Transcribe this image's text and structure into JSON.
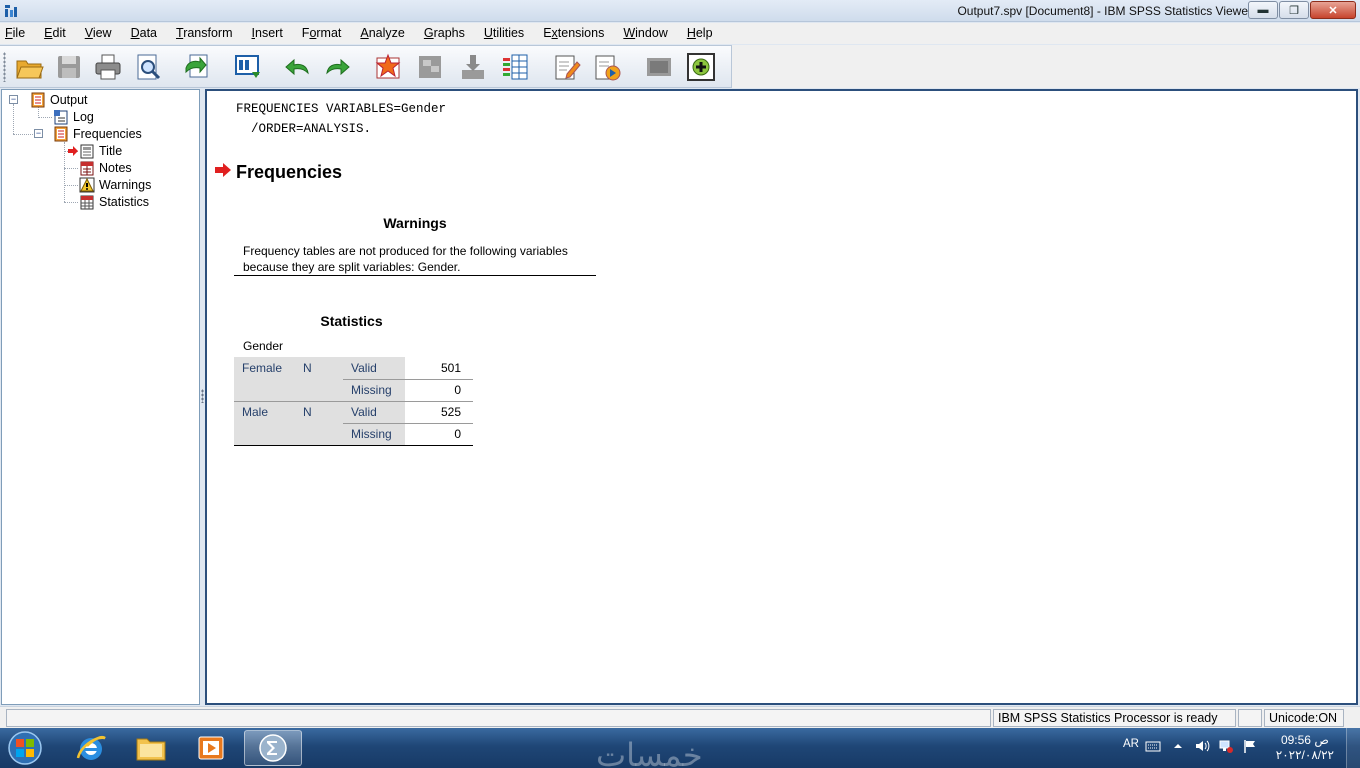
{
  "window": {
    "title": "Output7.spv [Document8] - IBM SPSS Statistics Viewer",
    "minimize": "▬",
    "maximize": "❐",
    "close": "✕"
  },
  "menu": [
    {
      "label": "File",
      "u": "F",
      "rest": "ile"
    },
    {
      "label": "Edit",
      "u": "E",
      "rest": "dit"
    },
    {
      "label": "View",
      "u": "V",
      "rest": "iew"
    },
    {
      "label": "Data",
      "u": "D",
      "rest": "ata"
    },
    {
      "label": "Transform",
      "u": "T",
      "rest": "ransform"
    },
    {
      "label": "Insert",
      "u": "I",
      "rest": "nsert"
    },
    {
      "label": "Format",
      "pre": "F",
      "u": "o",
      "rest": "rmat"
    },
    {
      "label": "Analyze",
      "u": "A",
      "rest": "nalyze"
    },
    {
      "label": "Graphs",
      "u": "G",
      "rest": "raphs"
    },
    {
      "label": "Utilities",
      "u": "U",
      "rest": "tilities"
    },
    {
      "label": "Extensions",
      "pre": "E",
      "u": "x",
      "rest": "tensions"
    },
    {
      "label": "Window",
      "u": "W",
      "rest": "indow"
    },
    {
      "label": "Help",
      "u": "H",
      "rest": "elp"
    }
  ],
  "toolbar": [
    {
      "name": "open-icon"
    },
    {
      "name": "save-icon"
    },
    {
      "name": "print-icon"
    },
    {
      "name": "print-preview-icon"
    },
    {
      "name": "export-icon"
    },
    {
      "name": "recall-dialog-icon"
    },
    {
      "name": "undo-icon"
    },
    {
      "name": "redo-icon"
    },
    {
      "name": "goto-data-icon"
    },
    {
      "name": "goto-case-icon"
    },
    {
      "name": "goto-variable-icon"
    },
    {
      "name": "variables-icon"
    },
    {
      "name": "insert-heading-icon"
    },
    {
      "name": "insert-title-icon"
    },
    {
      "name": "show-hide-icon"
    },
    {
      "name": "promote-icon"
    }
  ],
  "tree": {
    "output": "Output",
    "log": "Log",
    "frequencies": "Frequencies",
    "title": "Title",
    "notes": "Notes",
    "warnings": "Warnings",
    "statistics": "Statistics"
  },
  "output": {
    "syntax_line1": "FREQUENCIES VARIABLES=Gender",
    "syntax_line2": "  /ORDER=ANALYSIS.",
    "heading": "Frequencies",
    "warnings": {
      "title": "Warnings",
      "line1": "Frequency tables are not produced for the following variables",
      "line2": "because they are split variables: Gender."
    },
    "statistics": {
      "title": "Statistics",
      "caption": "Gender",
      "rows": [
        {
          "group": "Female",
          "stat": "N",
          "label": "Valid",
          "value": "501"
        },
        {
          "group": "",
          "stat": "",
          "label": "Missing",
          "value": "0"
        },
        {
          "group": "Male",
          "stat": "N",
          "label": "Valid",
          "value": "525"
        },
        {
          "group": "",
          "stat": "",
          "label": "Missing",
          "value": "0"
        }
      ]
    }
  },
  "status": {
    "processor": "IBM SPSS Statistics Processor is ready",
    "unicode": "Unicode:ON"
  },
  "taskbar": {
    "watermark": "خمسات",
    "language": "AR",
    "time": "09:56 ص",
    "date": "٢٠٢٢/٠٨/٢٢"
  }
}
